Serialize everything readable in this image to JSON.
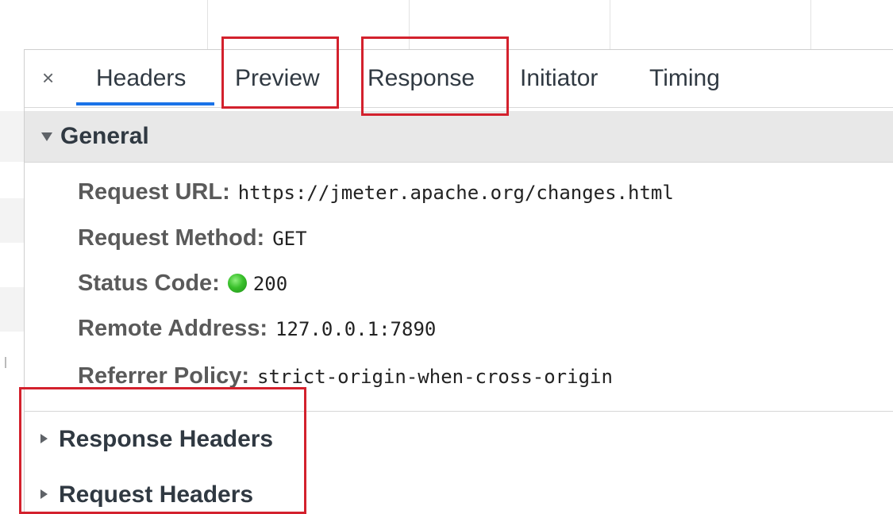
{
  "tabs": {
    "close": "×",
    "items": [
      "Headers",
      "Preview",
      "Response",
      "Initiator",
      "Timing"
    ],
    "active": "Headers"
  },
  "general": {
    "title": "General",
    "rows": [
      {
        "key": "Request URL:",
        "value": "https://jmeter.apache.org/changes.html"
      },
      {
        "key": "Request Method:",
        "value": "GET"
      },
      {
        "key": "Status Code:",
        "value": "200"
      },
      {
        "key": "Remote Address:",
        "value": "127.0.0.1:7890"
      },
      {
        "key": "Referrer Policy:",
        "value": "strict-origin-when-cross-origin"
      }
    ]
  },
  "collapsed_sections": [
    "Response Headers",
    "Request Headers"
  ],
  "colors": {
    "tab_underline": "#1a73e8",
    "status_ok": "#39c02b",
    "annotation": "#d3212d"
  },
  "icons": {
    "close": "close-icon",
    "expanded": "triangle-down-icon",
    "collapsed": "triangle-right-icon",
    "status": "green-dot-icon"
  }
}
